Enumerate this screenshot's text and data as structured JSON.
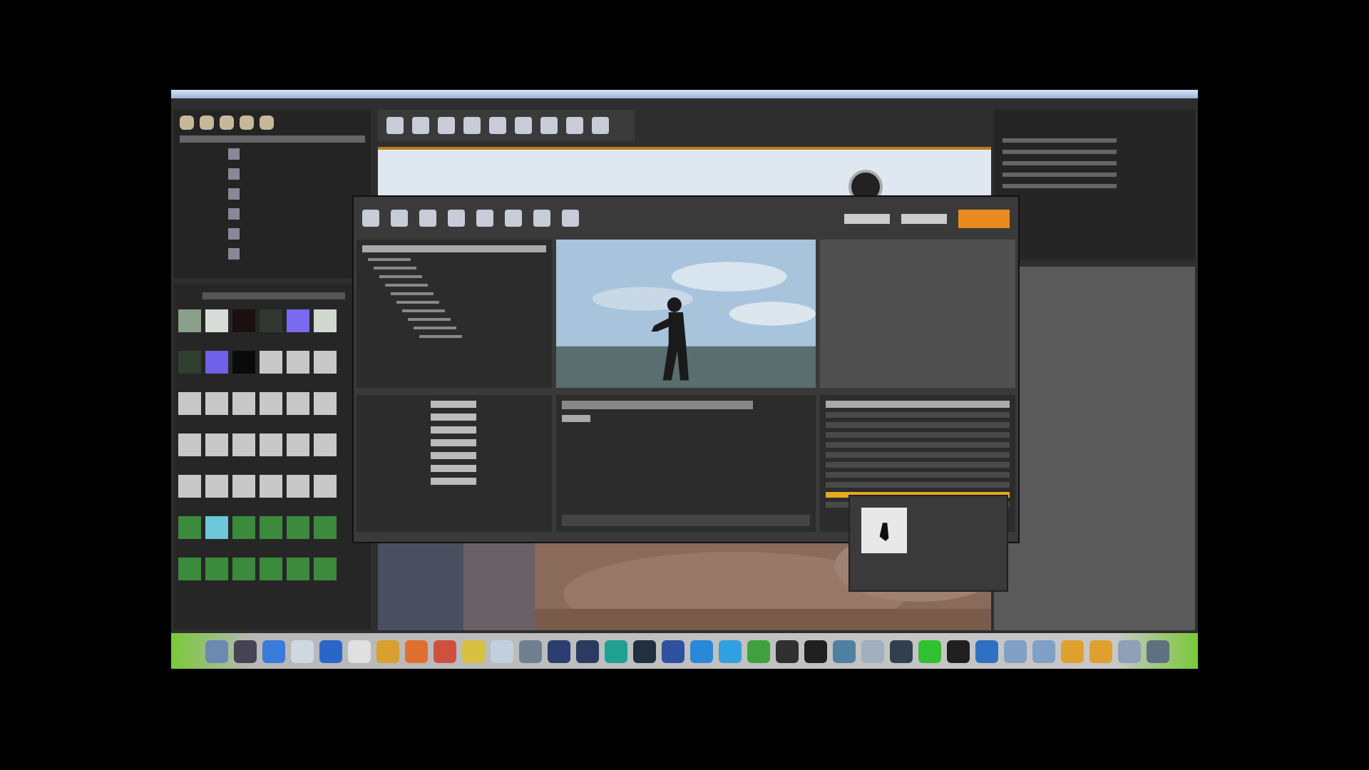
{
  "content_browser": {
    "tiles": [
      {
        "color": "#8aa08a"
      },
      {
        "color": "#d8dcd8"
      },
      {
        "color": "#1a1010"
      },
      {
        "color": "#303830"
      },
      {
        "color": "#7a6af0"
      },
      {
        "color": "#d0d8d0"
      },
      {
        "color": "#304030"
      },
      {
        "color": "#7060e8"
      },
      {
        "color": "#0a0a0a"
      },
      {
        "color": "#c8c8c8"
      },
      {
        "color": "#c8c8c8"
      },
      {
        "color": "#c8c8c8"
      },
      {
        "color": "#c8c8c8"
      },
      {
        "color": "#c8c8c8"
      },
      {
        "color": "#c8c8c8"
      },
      {
        "color": "#c8c8c8"
      },
      {
        "color": "#c8c8c8"
      },
      {
        "color": "#c8c8c8"
      },
      {
        "color": "#c8c8c8"
      },
      {
        "color": "#c8c8c8"
      },
      {
        "color": "#c8c8c8"
      },
      {
        "color": "#c8c8c8"
      },
      {
        "color": "#c8c8c8"
      },
      {
        "color": "#c8c8c8"
      },
      {
        "color": "#c8c8c8"
      },
      {
        "color": "#c8c8c8"
      },
      {
        "color": "#c8c8c8"
      },
      {
        "color": "#c8c8c8"
      },
      {
        "color": "#c8c8c8"
      },
      {
        "color": "#c8c8c8"
      },
      {
        "color": "#3c8a3c"
      },
      {
        "color": "#6ac8d8"
      },
      {
        "color": "#3c8a3c"
      },
      {
        "color": "#3c8a3c"
      },
      {
        "color": "#3c8a3c"
      },
      {
        "color": "#3c8a3c"
      },
      {
        "color": "#3c8a3c"
      },
      {
        "color": "#3c8a3c"
      },
      {
        "color": "#3c8a3c"
      },
      {
        "color": "#3c8a3c"
      },
      {
        "color": "#3c8a3c"
      },
      {
        "color": "#3c8a3c"
      }
    ]
  },
  "asset_list": {
    "rows": [
      {
        "selected": false
      },
      {
        "selected": false
      },
      {
        "selected": false
      },
      {
        "selected": false
      },
      {
        "selected": false
      },
      {
        "selected": false
      },
      {
        "selected": false
      },
      {
        "selected": false
      },
      {
        "selected": true
      },
      {
        "selected": false
      }
    ]
  }
}
